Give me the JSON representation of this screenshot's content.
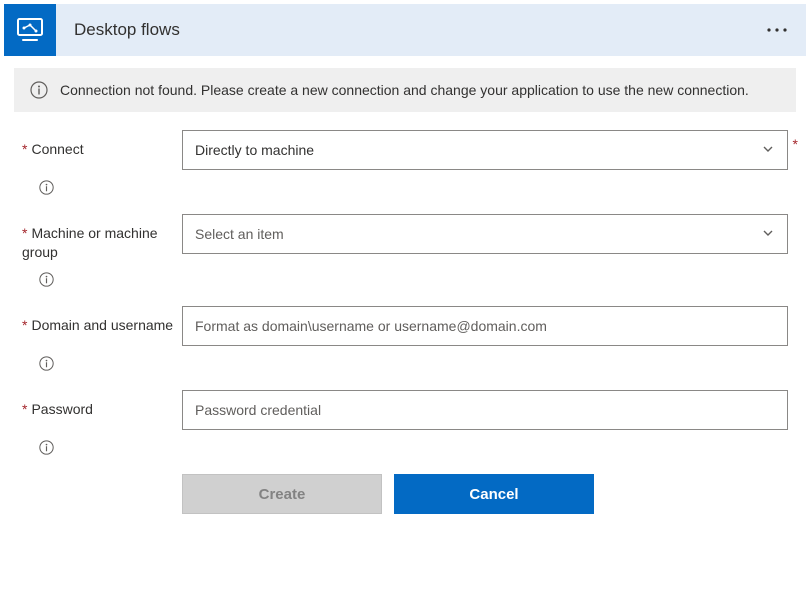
{
  "header": {
    "title": "Desktop flows",
    "icon": "desktop-flow-icon"
  },
  "warning": {
    "message": "Connection not found. Please create a new connection and change your application to use the new connection."
  },
  "form": {
    "connect": {
      "label": "Connect",
      "value": "Directly to machine"
    },
    "machine": {
      "label": "Machine or machine group",
      "placeholder": "Select an item"
    },
    "domain": {
      "label": "Domain and username",
      "placeholder": "Format as domain\\username or username@domain.com"
    },
    "password": {
      "label": "Password",
      "placeholder": "Password credential"
    }
  },
  "buttons": {
    "create": "Create",
    "cancel": "Cancel"
  }
}
